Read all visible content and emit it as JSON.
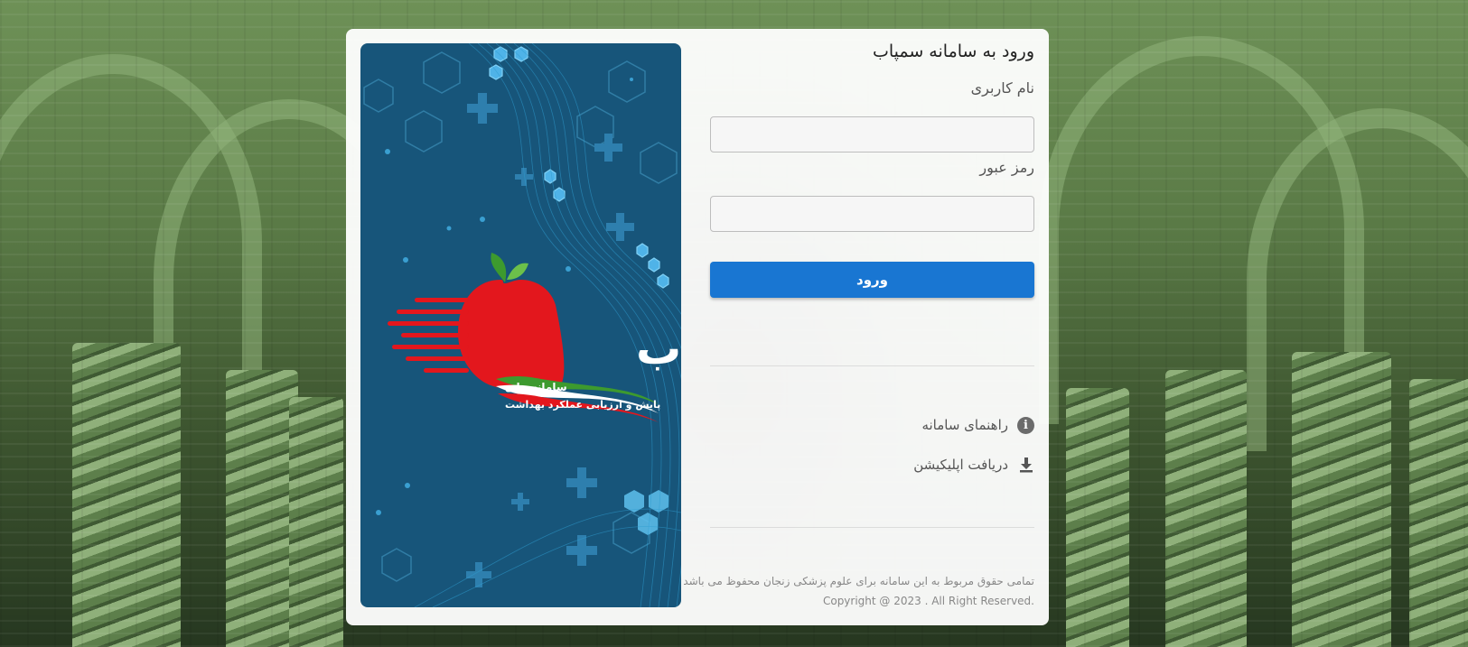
{
  "login_form": {
    "title": "ورود به سامانه سمپاب",
    "username_label": "نام کاربری",
    "username_value": "",
    "password_label": "رمز عبور",
    "password_value": "",
    "submit_label": "ورود"
  },
  "links": {
    "system_guide": "راهنمای سامانه",
    "download_app": "دریافت اپلیکیشن"
  },
  "brand": {
    "logo_name": "سمپاب",
    "tagline_line1": "سامانه ملی",
    "tagline_line2": "پایش و ارزیابی عملکرد بهداشت"
  },
  "footer": {
    "rights_text": "تمامی حقوق مربوط به این سامانه برای علوم پزشکی زنجان محفوظ می باشد",
    "copyright_text": "Copyright @ 2023 . All Right Reserved."
  },
  "colors": {
    "primary_button": "#1976d2",
    "brand_panel": "#17557a",
    "logo_red": "#e3171d",
    "leaf_green": "#3d9a2e"
  },
  "icons": {
    "guide": "info-icon",
    "download": "download-icon"
  }
}
